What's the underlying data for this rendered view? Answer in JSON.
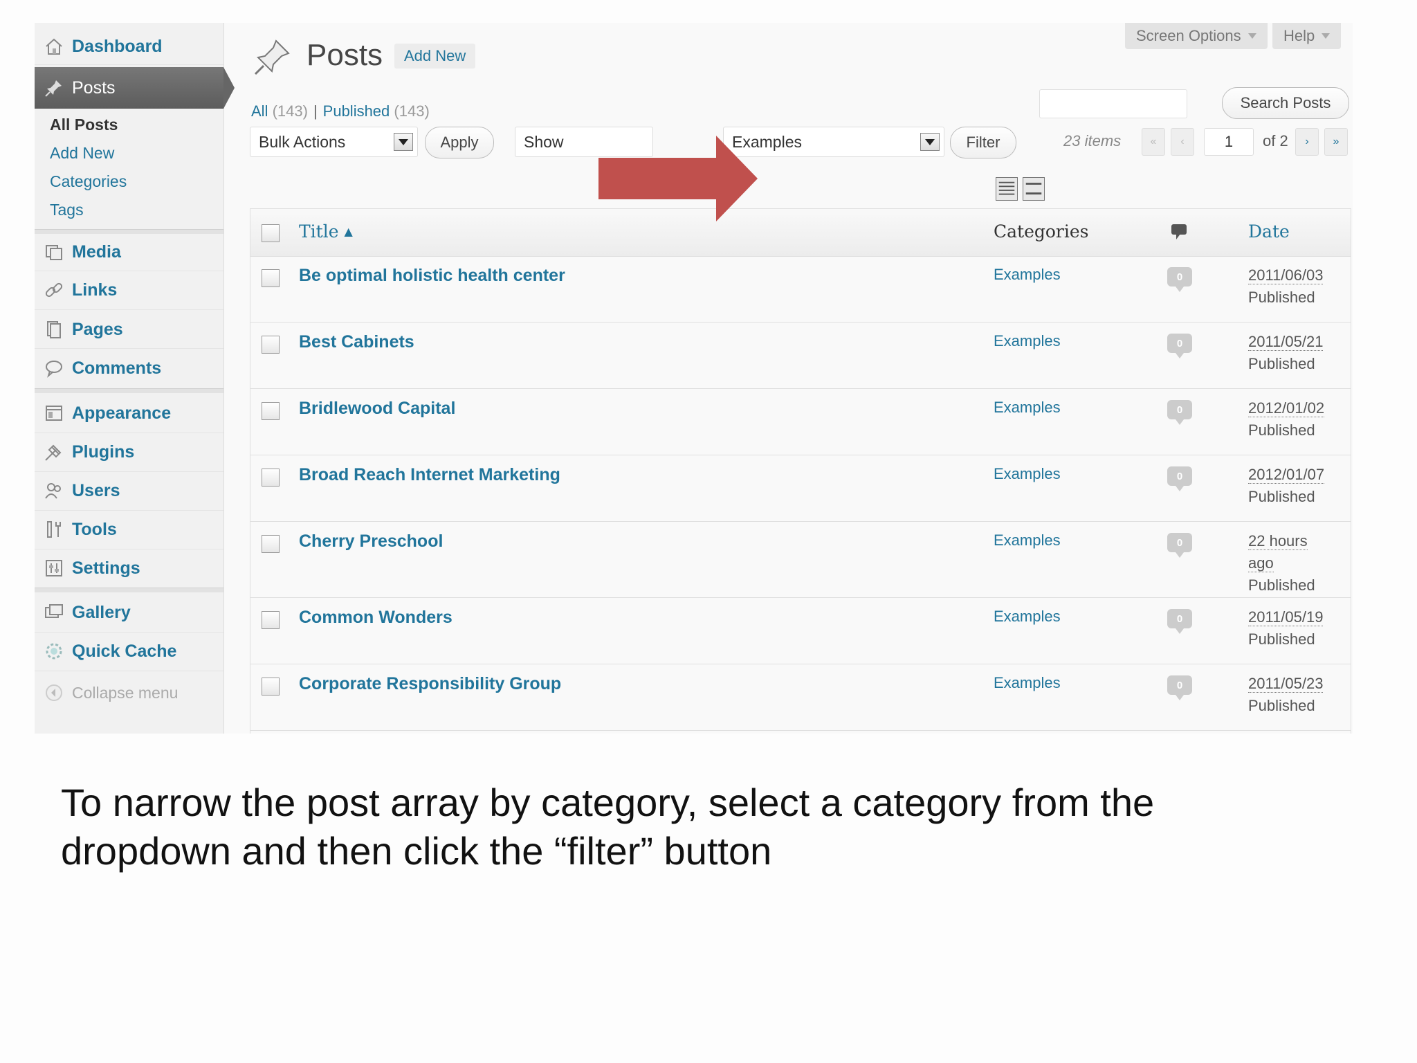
{
  "sidebar": {
    "items": [
      {
        "label": "Dashboard",
        "icon": "house-icon"
      },
      {
        "label": "Posts",
        "icon": "pushpin-icon"
      },
      {
        "label": "Media",
        "icon": "media-icon"
      },
      {
        "label": "Links",
        "icon": "chain-link-icon"
      },
      {
        "label": "Pages",
        "icon": "pages-icon"
      },
      {
        "label": "Comments",
        "icon": "speech-bubble-icon"
      },
      {
        "label": "Appearance",
        "icon": "appearance-icon"
      },
      {
        "label": "Plugins",
        "icon": "plug-icon"
      },
      {
        "label": "Users",
        "icon": "users-icon"
      },
      {
        "label": "Tools",
        "icon": "tools-icon"
      },
      {
        "label": "Settings",
        "icon": "settings-icon"
      },
      {
        "label": "Gallery",
        "icon": "gallery-icon"
      },
      {
        "label": "Quick Cache",
        "icon": "cache-gear-icon"
      }
    ],
    "submenu": [
      "All Posts",
      "Add New",
      "Categories",
      "Tags"
    ],
    "collapse_label": "Collapse menu"
  },
  "header": {
    "title": "Posts",
    "add_new": "Add New",
    "screen_options": "Screen Options",
    "help": "Help"
  },
  "views": {
    "all_label": "All",
    "all_count": "(143)",
    "separator": "|",
    "published_label": "Published",
    "published_count": "(143)"
  },
  "search": {
    "button": "Search Posts",
    "value": ""
  },
  "toolbar": {
    "bulk_actions": "Bulk Actions",
    "apply": "Apply",
    "show_partial": "Show",
    "category_selected": "Examples",
    "filter": "Filter",
    "items_count": "23 items",
    "page_current": "1",
    "page_of": "of 2"
  },
  "table": {
    "headers": {
      "title": "Title",
      "categories": "Categories",
      "date": "Date"
    },
    "rows": [
      {
        "title": "Be optimal holistic health center",
        "category": "Examples",
        "comments": "0",
        "date": "2011/06/03",
        "status": "Published"
      },
      {
        "title": "Best Cabinets",
        "category": "Examples",
        "comments": "0",
        "date": "2011/05/21",
        "status": "Published"
      },
      {
        "title": "Bridlewood Capital",
        "category": "Examples",
        "comments": "0",
        "date": "2012/01/02",
        "status": "Published"
      },
      {
        "title": "Broad Reach Internet Marketing",
        "category": "Examples",
        "comments": "0",
        "date": "2012/01/07",
        "status": "Published"
      },
      {
        "title": "Cherry Preschool",
        "category": "Examples",
        "comments": "0",
        "date": "22 hours",
        "date2": "ago",
        "status": "Published"
      },
      {
        "title": "Common Wonders",
        "category": "Examples",
        "comments": "0",
        "date": "2011/05/19",
        "status": "Published"
      },
      {
        "title": "Corporate Responsibility Group",
        "category": "Examples",
        "comments": "0",
        "date": "2011/05/23",
        "status": "Published"
      }
    ]
  },
  "colors": {
    "link": "#21759b",
    "arrow": "#c0504d",
    "menu_current": "#666666"
  },
  "caption": {
    "line1": "To narrow the post array by category, select a category from the",
    "line2": "dropdown and then click the “filter” button"
  }
}
